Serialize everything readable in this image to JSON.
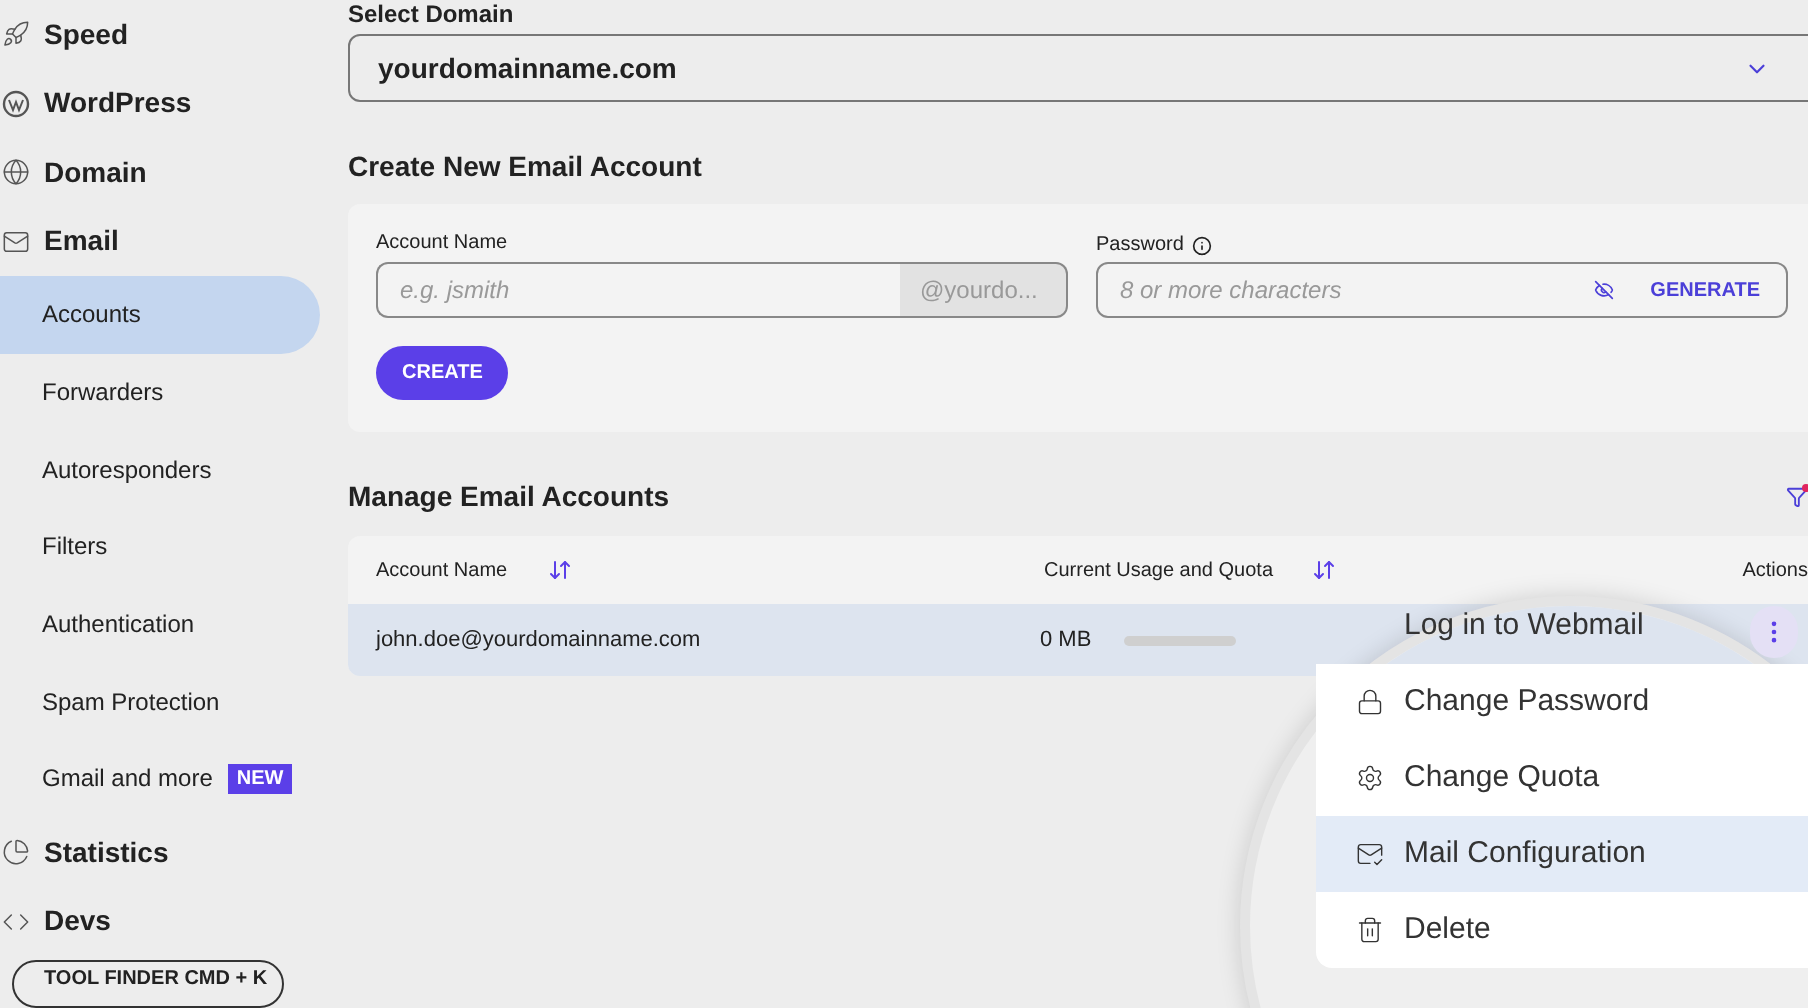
{
  "sidebar": {
    "sections": [
      {
        "label": "Speed"
      },
      {
        "label": "WordPress"
      },
      {
        "label": "Domain"
      },
      {
        "label": "Email",
        "children": [
          {
            "label": "Accounts",
            "selected": true
          },
          {
            "label": "Forwarders",
            "selected": false
          },
          {
            "label": "Autoresponders",
            "selected": false
          },
          {
            "label": "Filters",
            "selected": false
          },
          {
            "label": "Authentication",
            "selected": false
          },
          {
            "label": "Spam Protection",
            "selected": false
          },
          {
            "label": "Gmail and more",
            "selected": false,
            "badge": "NEW"
          }
        ]
      },
      {
        "label": "Statistics"
      },
      {
        "label": "Devs"
      }
    ],
    "tool_finder": "TOOL FINDER CMD + K"
  },
  "domain": {
    "label": "Select Domain",
    "value": "yourdomainname.com"
  },
  "create": {
    "title": "Create New Email Account",
    "account_label": "Account Name",
    "account_placeholder": "e.g. jsmith",
    "account_suffix": "@yourdo...",
    "password_label": "Password",
    "password_placeholder": "8 or more characters",
    "generate": "GENERATE",
    "button": "CREATE"
  },
  "manage": {
    "title": "Manage Email Accounts",
    "columns": [
      "Account Name",
      "Current Usage and Quota",
      "Actions"
    ],
    "rows": [
      {
        "account": "john.doe@yourdomainname.com",
        "usage": "0 MB"
      }
    ]
  },
  "menu": [
    {
      "label": "Log in to Webmail",
      "selected": false
    },
    {
      "label": "Change Password",
      "selected": false
    },
    {
      "label": "Change Quota",
      "selected": false
    },
    {
      "label": "Mail Configuration",
      "selected": true
    },
    {
      "label": "Delete",
      "selected": false
    }
  ]
}
